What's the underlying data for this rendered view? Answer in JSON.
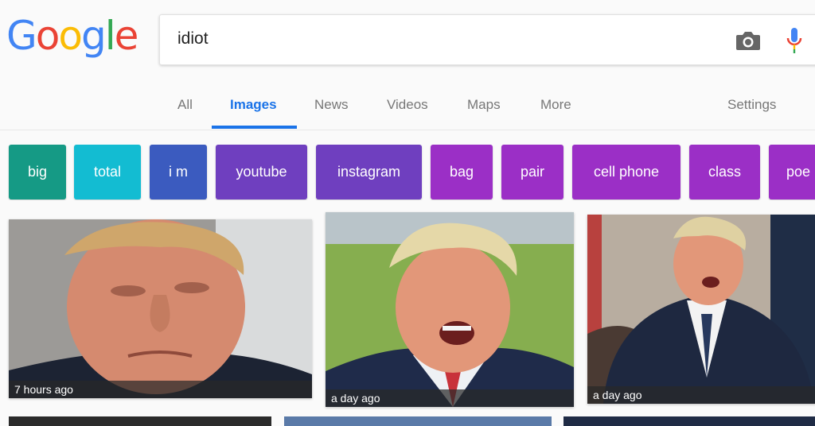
{
  "logo": {
    "letters": [
      "G",
      "o",
      "o",
      "g",
      "l",
      "e"
    ]
  },
  "search": {
    "query": "idiot"
  },
  "tabs": [
    {
      "label": "All"
    },
    {
      "label": "Images",
      "active": true
    },
    {
      "label": "News"
    },
    {
      "label": "Videos"
    },
    {
      "label": "Maps"
    },
    {
      "label": "More"
    }
  ],
  "settings_label": "Settings",
  "chips": [
    {
      "label": "big",
      "color": "#159a85"
    },
    {
      "label": "total",
      "color": "#13bcd2"
    },
    {
      "label": "i m",
      "color": "#3b5bbf"
    },
    {
      "label": "youtube",
      "color": "#6f3fbf"
    },
    {
      "label": "instagram",
      "color": "#6f3fbf"
    },
    {
      "label": "bag",
      "color": "#9b2fc6"
    },
    {
      "label": "pair",
      "color": "#9b2fc6"
    },
    {
      "label": "cell phone",
      "color": "#9b2fc6"
    },
    {
      "label": "class",
      "color": "#9b2fc6"
    },
    {
      "label": "poe",
      "color": "#9b2fc6"
    }
  ],
  "results": [
    {
      "age": "7 hours ago"
    },
    {
      "age": "a day ago"
    },
    {
      "age": "a day ago"
    }
  ],
  "colors": {
    "accent_blue": "#1a73e8",
    "google_blue": "#4285f4",
    "google_red": "#ea4335",
    "google_yellow": "#fbbc05",
    "google_green": "#34a853"
  }
}
